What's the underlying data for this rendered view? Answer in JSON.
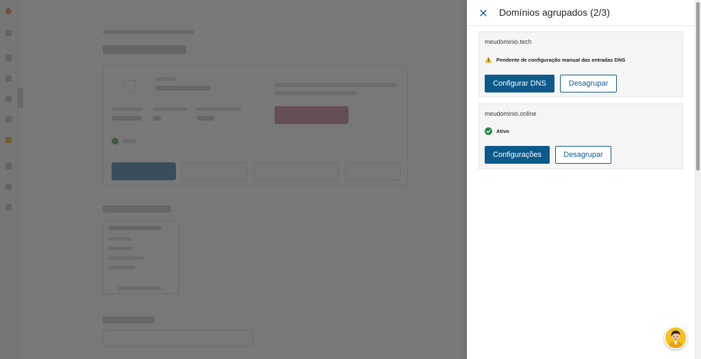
{
  "drawer": {
    "title": "Domínios agrupados (2/3)",
    "close_icon": "close-icon"
  },
  "domains": [
    {
      "name": "meudominio.tech",
      "status_icon": "warning-icon",
      "status_color": "#f2b416",
      "status_text": "Pendente de configuração manual das entradas DNS",
      "primary_label": "Configurar DNS",
      "secondary_label": "Desagrupar"
    },
    {
      "name": "meudominio.online",
      "status_icon": "check-circle-icon",
      "status_color": "#1f8a45",
      "status_text": "Ativo",
      "primary_label": "Configurações",
      "secondary_label": "Desagrupar"
    }
  ],
  "chat": {
    "icon": "support-avatar-icon"
  },
  "colors": {
    "primary": "#0c5a8a",
    "overlay": "#3e3e3e",
    "brand": "#e87a1f"
  }
}
